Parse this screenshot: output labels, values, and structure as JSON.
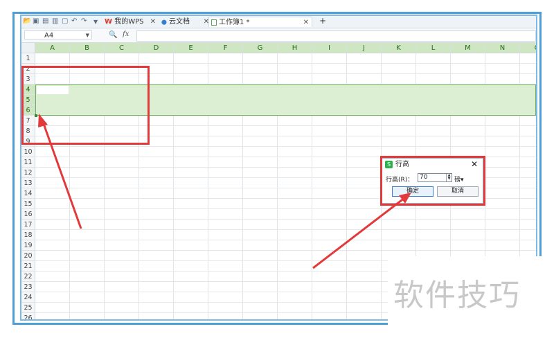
{
  "tabbar": {
    "quick_icons": [
      "folder-icon",
      "save-icon",
      "print-preview-icon",
      "print-icon",
      "export-pdf-icon",
      "undo-icon",
      "redo-icon",
      "dropdown-icon"
    ],
    "tabs": [
      {
        "icon_text": "W",
        "label": "我的WPS",
        "close": "✕"
      },
      {
        "icon_text": "⬤",
        "label": "云文档",
        "close": "✕"
      },
      {
        "icon_text": "",
        "label": "工作簿1 *",
        "close": "✕"
      }
    ],
    "new_tab": "+"
  },
  "formula_bar": {
    "name_box": "A4",
    "zoom_symbol": "🔍",
    "fx": "fx",
    "formula_value": ""
  },
  "grid": {
    "columns": [
      "A",
      "B",
      "C",
      "D",
      "E",
      "F",
      "G",
      "H",
      "I",
      "J",
      "K",
      "L",
      "M",
      "N",
      "O"
    ],
    "rows": [
      "1",
      "2",
      "3",
      "4",
      "5",
      "6",
      "7",
      "8",
      "9",
      "10",
      "11",
      "12",
      "13",
      "14",
      "15",
      "16",
      "17",
      "18",
      "19",
      "20",
      "21",
      "22",
      "23",
      "24",
      "25",
      "26"
    ],
    "selected_rows": [
      "4",
      "5",
      "6"
    ],
    "active_cell": "A4"
  },
  "dialog": {
    "title": "行高",
    "close": "✕",
    "label": "行高(R)：",
    "value": "70",
    "unit": "磅▾",
    "ok": "确定",
    "cancel": "取消"
  },
  "watermark": {
    "text": "软件技巧"
  },
  "annotation_color": "#e23a3a",
  "selection_color": "#dcefd3"
}
